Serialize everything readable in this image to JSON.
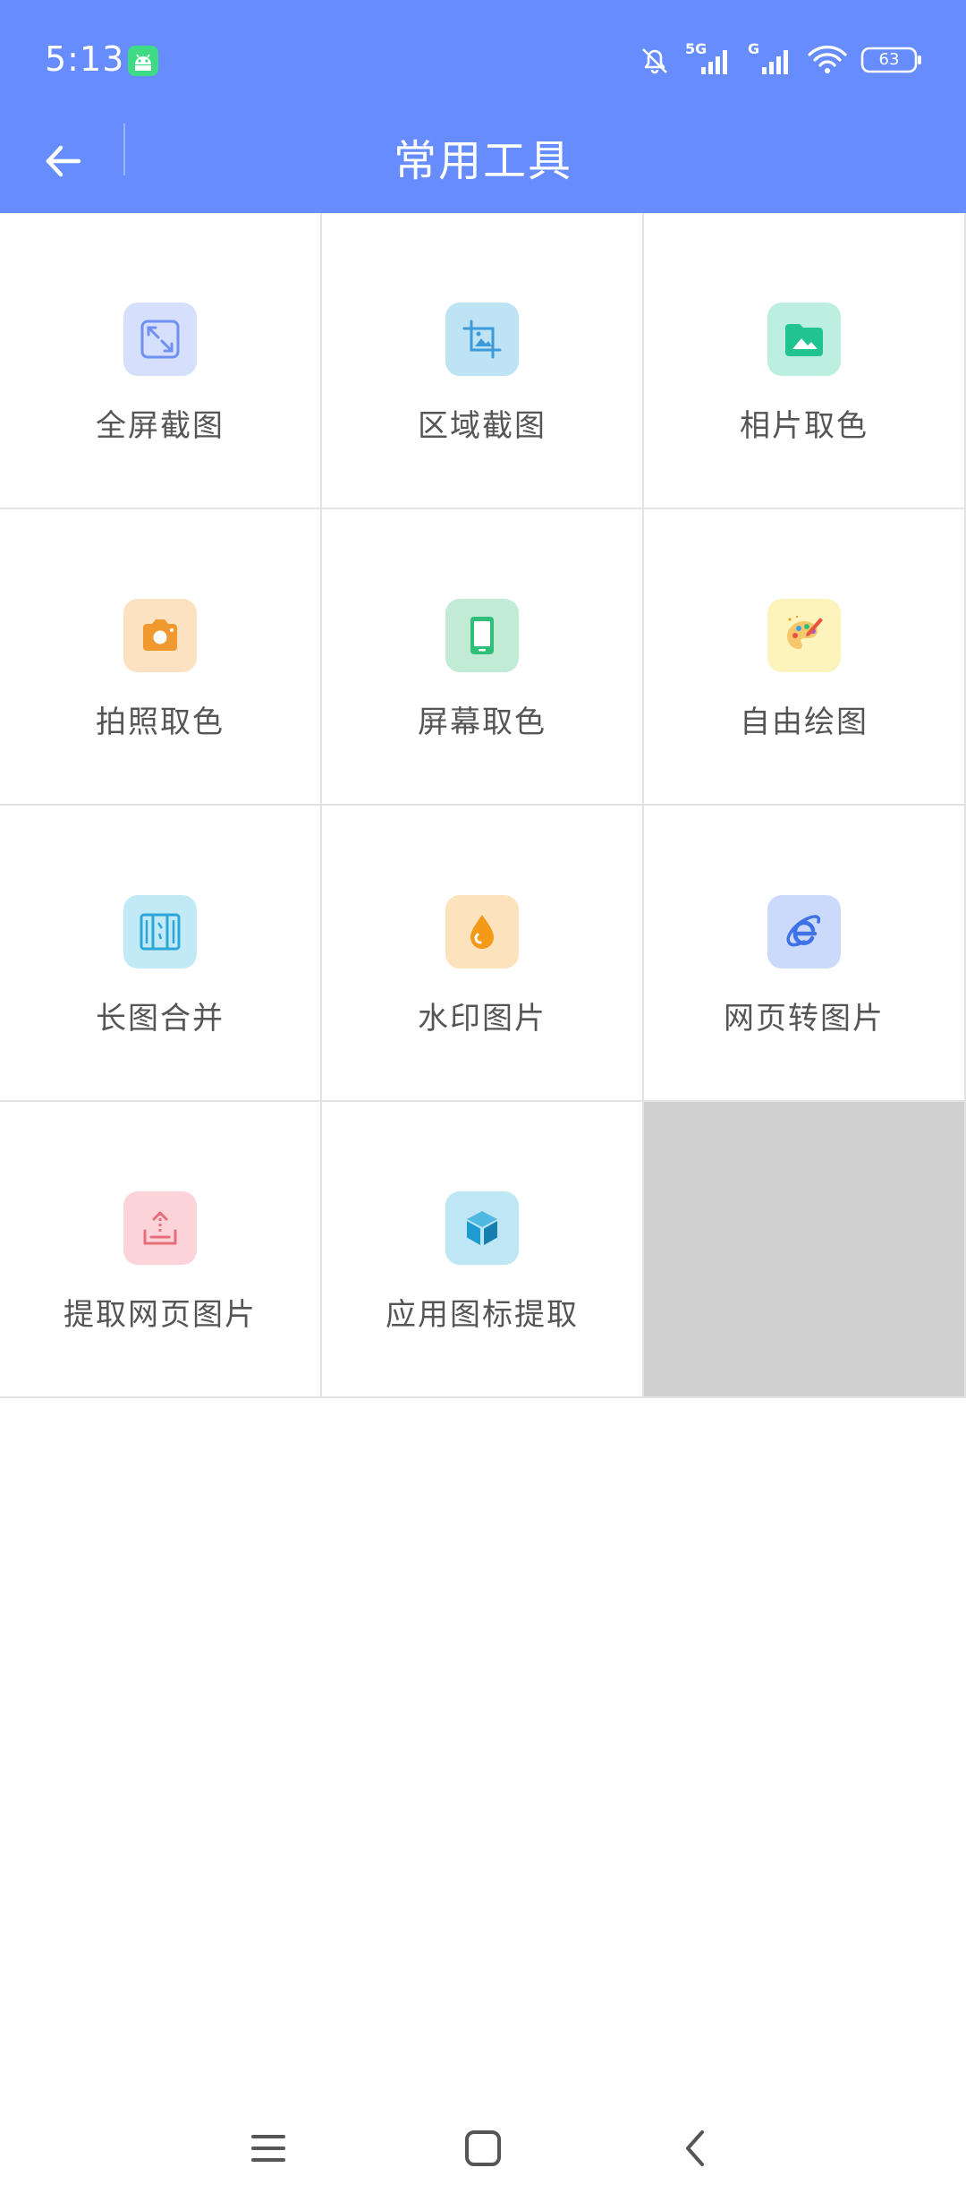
{
  "status_bar": {
    "time": "5:13",
    "battery": "63",
    "network_primary": "5G",
    "network_secondary": "G"
  },
  "toolbar": {
    "title": "常用工具"
  },
  "tools": [
    {
      "label": "全屏截图",
      "icon": "fullscreen-screenshot-icon",
      "bg": "#d6e0fd",
      "fg": "#6f91f2"
    },
    {
      "label": "区域截图",
      "icon": "region-screenshot-icon",
      "bg": "#bde3f5",
      "fg": "#3d9ad9"
    },
    {
      "label": "相片取色",
      "icon": "photo-color-picker-icon",
      "bg": "#bcefdf",
      "fg": "#21c48e"
    },
    {
      "label": "拍照取色",
      "icon": "camera-color-picker-icon",
      "bg": "#fde2c1",
      "fg": "#f0992f"
    },
    {
      "label": "屏幕取色",
      "icon": "screen-color-picker-icon",
      "bg": "#c2ebd6",
      "fg": "#2fbf79"
    },
    {
      "label": "自由绘图",
      "icon": "palette-icon",
      "bg": "#fdf3bd",
      "fg": "#f0a02a"
    },
    {
      "label": "长图合并",
      "icon": "long-image-merge-icon",
      "bg": "#c2e9f6",
      "fg": "#2aa7d8"
    },
    {
      "label": "水印图片",
      "icon": "watermark-drop-icon",
      "bg": "#fde3bd",
      "fg": "#f59a18"
    },
    {
      "label": "网页转图片",
      "icon": "browser-e-icon",
      "bg": "#cbdafb",
      "fg": "#3e72e6"
    },
    {
      "label": "提取网页图片",
      "icon": "upload-tray-icon",
      "bg": "#fbd3d8",
      "fg": "#e86d7c"
    },
    {
      "label": "应用图标提取",
      "icon": "cube-icon",
      "bg": "#bfe6f4",
      "fg": "#1e9bd0"
    }
  ],
  "nav": {
    "menu": "menu-icon",
    "home": "home-icon",
    "back": "back-icon"
  }
}
